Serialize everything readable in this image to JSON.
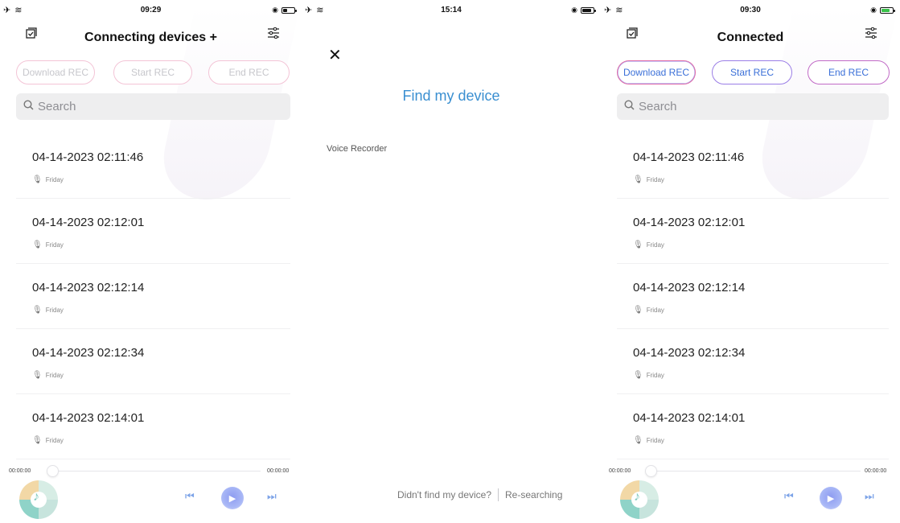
{
  "screens": [
    {
      "status": {
        "left": "✈ ≋",
        "time": "09:29",
        "right_icons": "◉",
        "battery_fill": 0.35,
        "charging": false
      },
      "header": {
        "title": "Connecting devices +"
      },
      "rec_buttons": [
        "Download REC",
        "Start REC",
        "End REC"
      ],
      "search": {
        "placeholder": "Search"
      },
      "recordings": [
        {
          "datetime": "04-14-2023 02:11:46",
          "day": "Friday"
        },
        {
          "datetime": "04-14-2023 02:12:01",
          "day": "Friday"
        },
        {
          "datetime": "04-14-2023 02:12:14",
          "day": "Friday"
        },
        {
          "datetime": "04-14-2023 02:12:34",
          "day": "Friday"
        },
        {
          "datetime": "04-14-2023 02:14:01",
          "day": "Friday"
        }
      ],
      "player": {
        "elapsed": "00:00:00",
        "total": "00:00:00",
        "progress": 0
      }
    },
    {
      "status": {
        "left": "✈ ≋",
        "time": "15:14",
        "right_icons": "◉",
        "battery_fill": 0.7,
        "charging": false
      },
      "find": {
        "title": "Find my device",
        "device": "Voice Recorder",
        "not_found": "Didn't find my device?",
        "research": "Re-searching"
      }
    },
    {
      "status": {
        "left": "✈ ≋",
        "time": "09:30",
        "right_icons": "◉",
        "battery_fill": 0.6,
        "charging": true
      },
      "header": {
        "title": "Connected"
      },
      "rec_buttons": [
        "Download REC",
        "Start REC",
        "End REC"
      ],
      "search": {
        "placeholder": "Search"
      },
      "recordings": [
        {
          "datetime": "04-14-2023 02:11:46",
          "day": "Friday"
        },
        {
          "datetime": "04-14-2023 02:12:01",
          "day": "Friday"
        },
        {
          "datetime": "04-14-2023 02:12:14",
          "day": "Friday"
        },
        {
          "datetime": "04-14-2023 02:12:34",
          "day": "Friday"
        },
        {
          "datetime": "04-14-2023 02:14:01",
          "day": "Friday"
        }
      ],
      "player": {
        "elapsed": "00:00:00",
        "total": "00:00:00",
        "progress": 0
      }
    }
  ],
  "icons": {
    "select": "select-all-icon",
    "filter": "filter-sliders-icon",
    "search": "search-icon",
    "mic": "microphone-icon",
    "close": "close-icon",
    "prev": "previous-track-icon",
    "play": "play-icon",
    "next": "next-track-icon"
  },
  "colors": {
    "accent_blue": "#3a8fd1",
    "pink": "#f0a8c8",
    "gradient_blue": "#6d8df0",
    "play_purple": "#8e9cf1"
  }
}
